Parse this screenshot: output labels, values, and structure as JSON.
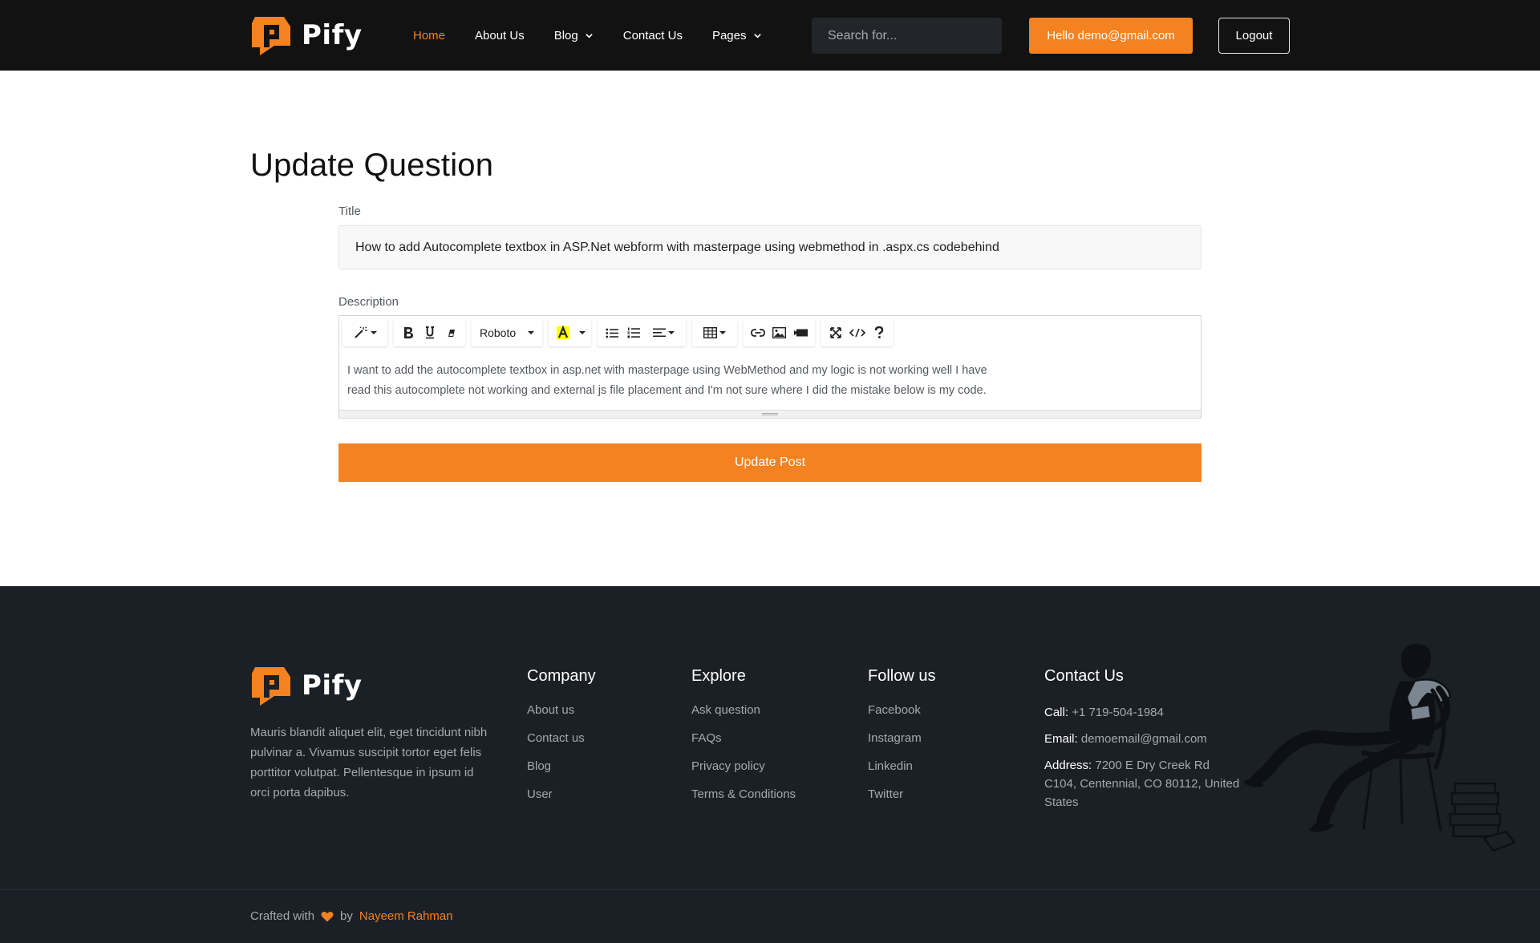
{
  "brand": {
    "name": "Pify",
    "accent_color": "#f58220"
  },
  "nav": {
    "items": [
      {
        "label": "Home",
        "active": true
      },
      {
        "label": "About Us"
      },
      {
        "label": "Blog",
        "has_dropdown": true
      },
      {
        "label": "Contact Us"
      },
      {
        "label": "Pages",
        "has_dropdown": true
      }
    ],
    "search_placeholder": "Search for...",
    "user_button": "Hello demo@gmail.com",
    "logout_button": "Logout"
  },
  "main": {
    "title": "Update Question",
    "title_field": {
      "label": "Title",
      "value": "How to add Autocomplete textbox in ASP.Net webform with masterpage using webmethod in .aspx.cs codebehind"
    },
    "description_field": {
      "label": "Description",
      "font": "Roboto",
      "line1": "I want to add the autocomplete textbox in asp.net with masterpage using WebMethod and my logic is not working well I have",
      "line2": "read this autocomplete not working and external js file placement and I'm not sure where I did the mistake below is my code."
    },
    "submit_button": "Update Post"
  },
  "footer": {
    "about": "Mauris blandit aliquet elit, eget tincidunt nibh pulvinar a. Vivamus suscipit tortor eget felis porttitor volutpat. Pellentesque in ipsum id orci porta dapibus.",
    "company": {
      "heading": "Company",
      "links": [
        "About us",
        "Contact us",
        "Blog",
        "User"
      ]
    },
    "explore": {
      "heading": "Explore",
      "links": [
        "Ask question",
        "FAQs",
        "Privacy policy",
        "Terms & Conditions"
      ]
    },
    "follow": {
      "heading": "Follow us",
      "links": [
        "Facebook",
        "Instagram",
        "Linkedin",
        "Twitter"
      ]
    },
    "contact": {
      "heading": "Contact Us",
      "call_label": "Call:",
      "call": "+1 719-504-1984",
      "email_label": "Email:",
      "email": "demoemail@gmail.com",
      "address_label": "Address:",
      "address": "7200 E Dry Creek Rd C104, Centennial, CO 80112, United States"
    },
    "credits": {
      "prefix": "Crafted with",
      "by": "by",
      "author": "Nayeem Rahman"
    }
  }
}
